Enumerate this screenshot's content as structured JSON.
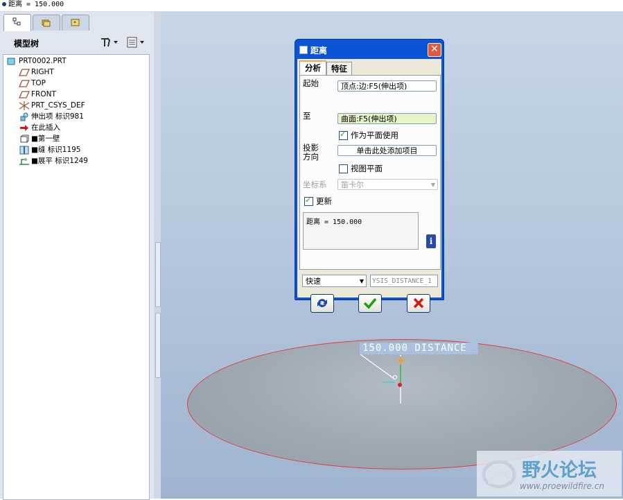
{
  "message": "距离 = 150.000",
  "model_tree": {
    "title": "模型树",
    "items": [
      {
        "label": "PRT0002.PRT",
        "icon": "part-icon"
      },
      {
        "label": "RIGHT",
        "icon": "datum-plane-icon"
      },
      {
        "label": "TOP",
        "icon": "datum-plane-icon"
      },
      {
        "label": "FRONT",
        "icon": "datum-plane-icon"
      },
      {
        "label": "PRT_CSYS_DEF",
        "icon": "csys-icon"
      },
      {
        "label": "伸出项 标识981",
        "icon": "extrude-icon"
      },
      {
        "label": "在此插入",
        "icon": "insert-arrow-icon"
      },
      {
        "label": "■第一壁",
        "icon": "sheetmetal-wall-icon"
      },
      {
        "label": "■缝 标识1195",
        "icon": "rip-icon"
      },
      {
        "label": "■展平 标识1249",
        "icon": "unbend-icon"
      }
    ]
  },
  "dialog": {
    "title": "距离",
    "tabs": [
      "分析",
      "特征"
    ],
    "from_label": "起始",
    "from_value": "顶点:边:F5(伸出项)",
    "to_label": "至",
    "to_value": "曲面:F5(伸出项)",
    "use_plane_label": "作为平面使用",
    "use_plane_checked": true,
    "projection_label_1": "投影",
    "projection_label_2": "方向",
    "projection_value": "单击此处添加项目",
    "view_plane_label": "视图平面",
    "view_plane_checked": false,
    "csys_label": "坐标系",
    "csys_value": "笛卡尔",
    "update_label": "更新",
    "update_checked": true,
    "result": "距离 = 150.000",
    "mode_value": "快速",
    "name_value": "YSIS_DISTANCE_1"
  },
  "viewport": {
    "dimension_text": "150.000  DISTANCE"
  },
  "watermark": {
    "text": "野火论坛",
    "url": "www.proewildfire.cn"
  },
  "colors": {
    "dialog_title": "#0b52d6",
    "surface_edge": "#e53c3c",
    "viewport_bg": "#b7c8de"
  }
}
